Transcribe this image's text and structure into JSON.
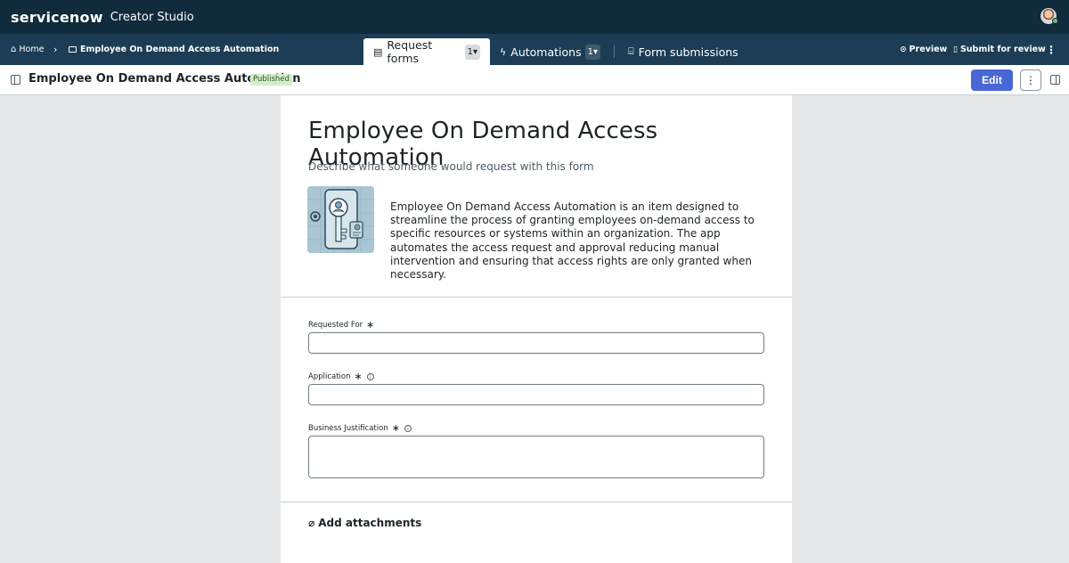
{
  "topbar": {
    "brand": "servicenow",
    "product": "Creator Studio"
  },
  "breadcrumb": {
    "home": "Home",
    "current": "Employee On Demand Access Automation"
  },
  "tabs": [
    {
      "label": "Request forms",
      "count": "1▾",
      "icon": "form-icon",
      "active": true
    },
    {
      "label": "Automations",
      "count": "1▾",
      "icon": "lightning-icon",
      "active": false
    },
    {
      "label": "Form submissions",
      "icon": "inbox-icon",
      "active": false
    }
  ],
  "nav_actions": {
    "preview": "Preview",
    "submit": "Submit for review",
    "more": "⋮"
  },
  "titlebar": {
    "title": "Employee On Demand Access Automation",
    "status": "Published",
    "edit": "Edit",
    "more": "⋮"
  },
  "form": {
    "title": "Employee On Demand Access Automation",
    "subtitle": "Describe what someone would request with this form",
    "image_icon": "key-lock-illustration",
    "description": "Employee On Demand Access Automation is an item designed to streamline the process of granting employees on-demand access to specific resources or systems within an organization. The app automates the access request and approval reducing manual intervention and ensuring that access rights are only granted when necessary.",
    "fields": [
      {
        "label": "Requested For",
        "required": "∗",
        "value": "",
        "info": false
      },
      {
        "label": "Application",
        "required": "∗",
        "value": "",
        "info": true
      },
      {
        "label": "Business Justification",
        "required": "∗",
        "value": "",
        "info": true
      }
    ],
    "attachments": "Add attachments"
  },
  "colors": {
    "topbar": "#0f2b3c",
    "navbar": "#1c3d55",
    "accent": "#4a67d6",
    "published_badge": "#d5ecc9"
  }
}
